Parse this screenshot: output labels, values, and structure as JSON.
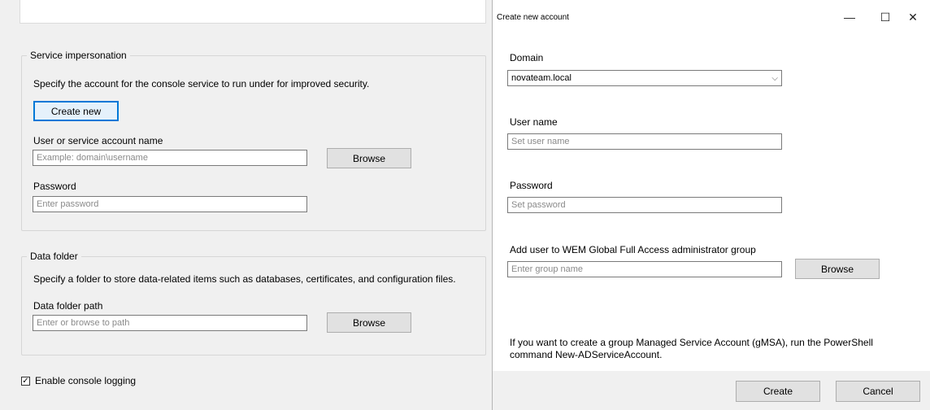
{
  "main": {
    "service_impersonation": {
      "legend": "Service impersonation",
      "description": "Specify the account for the console service to run under for improved security.",
      "create_new_label": "Create new",
      "account_label": "User or service account name",
      "account_placeholder": "Example: domain\\username",
      "browse_label": "Browse",
      "password_label": "Password",
      "password_placeholder": "Enter password"
    },
    "data_folder": {
      "legend": "Data folder",
      "description": "Specify a folder to store data-related items such as databases, certificates, and configuration files.",
      "path_label": "Data folder path",
      "path_placeholder": "Enter or browse to path",
      "browse_label": "Browse"
    },
    "logging": {
      "label": "Enable console logging",
      "checked": true
    }
  },
  "dialog": {
    "title": "Create new account",
    "controls": {
      "minimize": "—",
      "maximize": "☐",
      "close": "✕"
    },
    "domain_label": "Domain",
    "domain_value": "novateam.local",
    "username_label": "User name",
    "username_placeholder": "Set user name",
    "password_label": "Password",
    "password_placeholder": "Set password",
    "group_label": "Add user to WEM Global Full Access administrator group",
    "group_placeholder": "Enter group name",
    "browse_label": "Browse",
    "note": "If you want to create a group Managed Service Account (gMSA), run the PowerShell command New-ADServiceAccount.",
    "create_label": "Create",
    "cancel_label": "Cancel"
  }
}
